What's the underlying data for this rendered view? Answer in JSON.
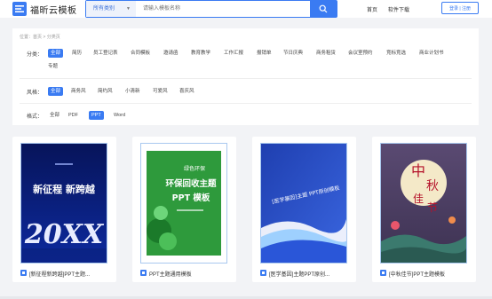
{
  "header": {
    "brand": "福昕云模板",
    "category_select": "所有类别",
    "search_placeholder": "请输入模板名称",
    "nav": [
      "首页",
      "软件下载"
    ],
    "login": "登录 | 注册"
  },
  "breadcrumb": "位置：首页 > 分类页",
  "filters": {
    "category_label": "分类：",
    "categories": [
      "全部",
      "简历",
      "员工登记表",
      "合同模板",
      "邀请函",
      "教育教学",
      "工作汇报",
      "报销单",
      "节日庆典",
      "商务租赁",
      "会议室预约",
      "竞标竞选",
      "商业计划书",
      "专题"
    ],
    "style_label": "风格：",
    "styles": [
      "全部",
      "商务风",
      "简约风",
      "小清新",
      "可爱风",
      "喜庆风"
    ],
    "format_label": "格式：",
    "formats": [
      "全部",
      "PDF",
      "PPT",
      "Word"
    ],
    "active": {
      "category": "全部",
      "style": "全部",
      "format": "PPT"
    }
  },
  "cards": [
    {
      "title": "[新征程新跨越]PPT主题...",
      "cover_text": [
        "新征程 新跨越",
        "20XX"
      ],
      "theme": "blue-dark"
    },
    {
      "title": "PPT主题通用模板",
      "cover_text": [
        "绿色环保",
        "环保回收主题",
        "PPT 模板"
      ],
      "theme": "green"
    },
    {
      "title": "[医学基因]主题PPT原创...",
      "cover_text": [
        "[医学基因]主题 PPT原创模板"
      ],
      "theme": "blue-wave"
    },
    {
      "title": "[中秋佳节]PPT主题模板",
      "cover_text": [
        "中",
        "秋",
        "佳",
        "节"
      ],
      "theme": "mid-autumn"
    }
  ],
  "colors": {
    "accent": "#3a7bf2",
    "background": "#f2f3f6"
  },
  "icons": {
    "logo": "template-logo-icon",
    "search": "search-icon",
    "file": "ppt-file-icon"
  }
}
